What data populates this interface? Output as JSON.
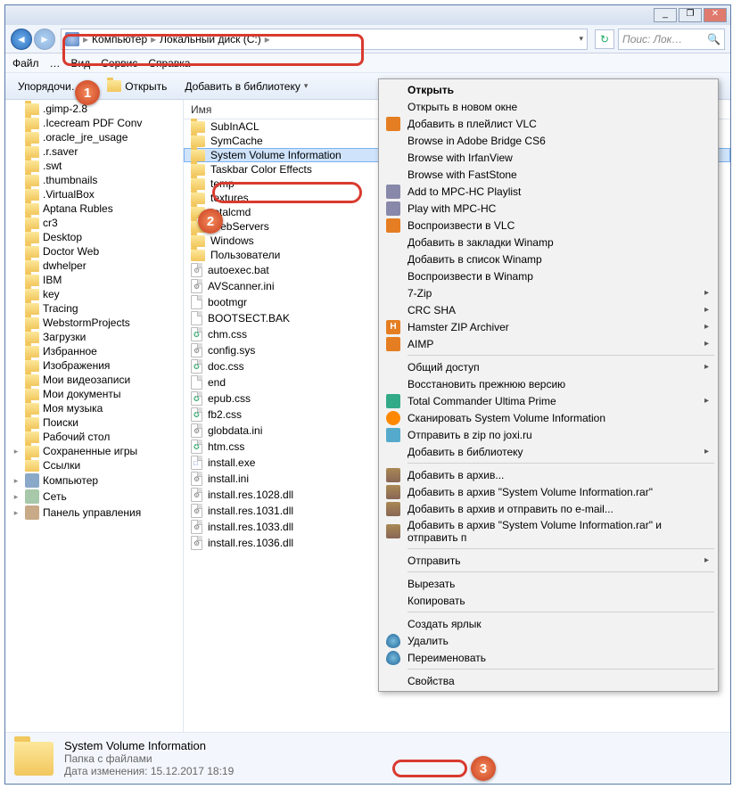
{
  "titlebar": {
    "min": "_",
    "max": "❐",
    "close": "✕"
  },
  "nav": {
    "breadcrumb": {
      "root": "Компьютер",
      "sep": "▸",
      "disk": "Локальный диск (C:)"
    },
    "search_placeholder": "Поис: Лок…"
  },
  "menubar": {
    "file": "Файл",
    "ed": "…",
    "view": "Вид",
    "service": "Сервис",
    "help": "Справка"
  },
  "toolbar": {
    "organize": "Упорядочи…",
    "open": "Открыть",
    "addlib": "Добавить в библиотеку"
  },
  "tree_items": [
    {
      "label": ".gimp-2.8"
    },
    {
      "label": ".Icecream PDF Conv"
    },
    {
      "label": ".oracle_jre_usage"
    },
    {
      "label": ".r.saver"
    },
    {
      "label": ".swt"
    },
    {
      "label": ".thumbnails"
    },
    {
      "label": ".VirtualBox"
    },
    {
      "label": "Aptana Rubles"
    },
    {
      "label": "cr3"
    },
    {
      "label": "Desktop"
    },
    {
      "label": "Doctor Web"
    },
    {
      "label": "dwhelper"
    },
    {
      "label": "IBM"
    },
    {
      "label": "key"
    },
    {
      "label": "Tracing"
    },
    {
      "label": "WebstormProjects"
    },
    {
      "label": "Загрузки"
    },
    {
      "label": "Избранное"
    },
    {
      "label": "Изображения"
    },
    {
      "label": "Мои видеозаписи"
    },
    {
      "label": "Мои документы"
    },
    {
      "label": "Моя музыка"
    },
    {
      "label": "Поиски"
    },
    {
      "label": "Рабочий стол"
    },
    {
      "label": "Сохраненные игры",
      "tw": "▸"
    },
    {
      "label": "Ссылки"
    }
  ],
  "tree_special": [
    {
      "label": "Компьютер",
      "cls": "comp",
      "tw": "▸"
    },
    {
      "label": "Сеть",
      "cls": "net",
      "tw": "▸"
    },
    {
      "label": "Панель управления",
      "cls": "cp",
      "tw": "▸"
    }
  ],
  "filelist_header": "Имя",
  "files": [
    {
      "label": "SubInACL",
      "type": "folder"
    },
    {
      "label": "SymCache",
      "type": "folder"
    },
    {
      "label": "System Volume Information",
      "type": "folder",
      "selected": true
    },
    {
      "label": "Taskbar Color Effects",
      "type": "folder"
    },
    {
      "label": "temp",
      "type": "folder"
    },
    {
      "label": "textures",
      "type": "folder"
    },
    {
      "label": "totalcmd",
      "type": "folder"
    },
    {
      "label": "WebServers",
      "type": "folder"
    },
    {
      "label": "Windows",
      "type": "folder"
    },
    {
      "label": "Пользователи",
      "type": "folder"
    },
    {
      "label": "autoexec.bat",
      "type": "bat"
    },
    {
      "label": "AVScanner.ini",
      "type": "gear"
    },
    {
      "label": "bootmgr",
      "type": "file"
    },
    {
      "label": "BOOTSECT.BAK",
      "type": "file"
    },
    {
      "label": "chm.css",
      "type": "css"
    },
    {
      "label": "config.sys",
      "type": "gear"
    },
    {
      "label": "doc.css",
      "type": "css"
    },
    {
      "label": "end",
      "type": "file"
    },
    {
      "label": "epub.css",
      "type": "css"
    },
    {
      "label": "fb2.css",
      "type": "css"
    },
    {
      "label": "globdata.ini",
      "type": "gear"
    },
    {
      "label": "htm.css",
      "type": "css"
    },
    {
      "label": "install.exe",
      "type": "exe"
    },
    {
      "label": "install.ini",
      "type": "gear"
    },
    {
      "label": "install.res.1028.dll",
      "type": "gear"
    },
    {
      "label": "install.res.1031.dll",
      "type": "gear"
    },
    {
      "label": "install.res.1033.dll",
      "type": "gear"
    },
    {
      "label": "install.res.1036.dll",
      "type": "gear"
    }
  ],
  "details": {
    "name": "System Volume Information",
    "type": "Папка с файлами",
    "date_lbl": "Дата изменения:",
    "date": "15.12.2017 18:19"
  },
  "ctx": [
    {
      "t": "item",
      "label": "Открыть",
      "bold": true
    },
    {
      "t": "item",
      "label": "Открыть в новом окне"
    },
    {
      "t": "item",
      "label": "Добавить в плейлист VLC",
      "icon": "ci-vlc"
    },
    {
      "t": "item",
      "label": "Browse in Adobe Bridge CS6"
    },
    {
      "t": "item",
      "label": "Browse with IrfanView"
    },
    {
      "t": "item",
      "label": "Browse with FastStone"
    },
    {
      "t": "item",
      "label": "Add to MPC-HC Playlist",
      "icon": "ci-film"
    },
    {
      "t": "item",
      "label": "Play with MPC-HC",
      "icon": "ci-film"
    },
    {
      "t": "item",
      "label": "Воспроизвести в VLC",
      "icon": "ci-vlc"
    },
    {
      "t": "item",
      "label": "Добавить в закладки Winamp"
    },
    {
      "t": "item",
      "label": "Добавить в список Winamp"
    },
    {
      "t": "item",
      "label": "Воспроизвести в Winamp"
    },
    {
      "t": "item",
      "label": "7-Zip",
      "arrow": true
    },
    {
      "t": "item",
      "label": "CRC SHA",
      "arrow": true
    },
    {
      "t": "item",
      "label": "Hamster ZIP Archiver",
      "icon": "ci-h",
      "arrow": true
    },
    {
      "t": "item",
      "label": "AIMP",
      "icon": "ci-aimp",
      "arrow": true
    },
    {
      "t": "sep"
    },
    {
      "t": "item",
      "label": "Общий доступ",
      "arrow": true
    },
    {
      "t": "item",
      "label": "Восстановить прежнюю версию"
    },
    {
      "t": "item",
      "label": "Total Commander Ultima Prime",
      "icon": "ci-tc",
      "arrow": true
    },
    {
      "t": "item",
      "label": "Сканировать System Volume Information",
      "icon": "ci-avast"
    },
    {
      "t": "item",
      "label": "Отправить в zip по joxi.ru",
      "icon": "ci-joxi"
    },
    {
      "t": "item",
      "label": "Добавить в библиотеку",
      "arrow": true
    },
    {
      "t": "sep"
    },
    {
      "t": "item",
      "label": "Добавить в архив...",
      "icon": "ci-rar"
    },
    {
      "t": "item",
      "label": "Добавить в архив \"System Volume Information.rar\"",
      "icon": "ci-rar"
    },
    {
      "t": "item",
      "label": "Добавить в архив и отправить по e-mail...",
      "icon": "ci-rar"
    },
    {
      "t": "item",
      "label": "Добавить в архив \"System Volume Information.rar\" и отправить п",
      "icon": "ci-rar"
    },
    {
      "t": "sep"
    },
    {
      "t": "item",
      "label": "Отправить",
      "arrow": true
    },
    {
      "t": "sep"
    },
    {
      "t": "item",
      "label": "Вырезать"
    },
    {
      "t": "item",
      "label": "Копировать"
    },
    {
      "t": "sep"
    },
    {
      "t": "item",
      "label": "Создать ярлык"
    },
    {
      "t": "item",
      "label": "Удалить",
      "icon": "ci-shield"
    },
    {
      "t": "item",
      "label": "Переименовать",
      "icon": "ci-shield"
    },
    {
      "t": "sep"
    },
    {
      "t": "item",
      "label": "Свойства"
    }
  ],
  "badges": {
    "1": "1",
    "2": "2",
    "3": "3"
  }
}
